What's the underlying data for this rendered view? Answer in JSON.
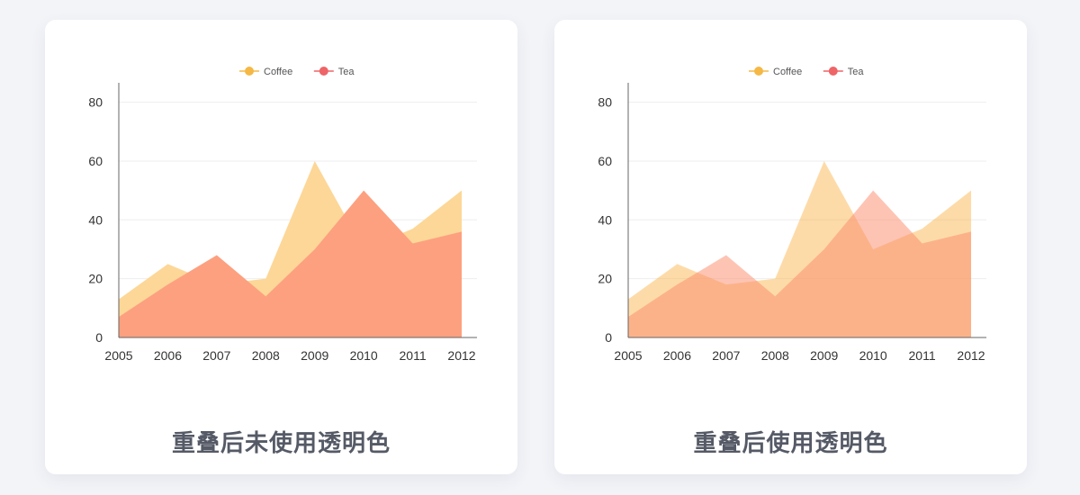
{
  "chart_data": [
    {
      "type": "area",
      "caption": "重叠后未使用透明色",
      "categories": [
        "2005",
        "2006",
        "2007",
        "2008",
        "2009",
        "2010",
        "2011",
        "2012"
      ],
      "series": [
        {
          "name": "Coffee",
          "values": [
            13,
            25,
            18,
            20,
            60,
            30,
            37,
            50
          ],
          "color": "#fdd797",
          "opacity": 1
        },
        {
          "name": "Tea",
          "values": [
            7,
            18,
            28,
            14,
            30,
            50,
            32,
            36
          ],
          "color": "#fda07f",
          "opacity": 1
        }
      ],
      "ylim": [
        0,
        86
      ],
      "yticks": [
        0,
        20,
        40,
        60,
        80
      ],
      "legend_position": "top-center",
      "legend_colors": {
        "Coffee": "#f5b845",
        "Tea": "#ee6467"
      }
    },
    {
      "type": "area",
      "caption": "重叠后使用透明色",
      "categories": [
        "2005",
        "2006",
        "2007",
        "2008",
        "2009",
        "2010",
        "2011",
        "2012"
      ],
      "series": [
        {
          "name": "Coffee",
          "values": [
            13,
            25,
            18,
            20,
            60,
            30,
            37,
            50
          ],
          "color": "#fbb040",
          "opacity": 0.45
        },
        {
          "name": "Tea",
          "values": [
            7,
            18,
            28,
            14,
            30,
            50,
            32,
            36
          ],
          "color": "#fb8a6a",
          "opacity": 0.5
        }
      ],
      "ylim": [
        0,
        86
      ],
      "yticks": [
        0,
        20,
        40,
        60,
        80
      ],
      "legend_position": "top-center",
      "legend_colors": {
        "Coffee": "#f5b845",
        "Tea": "#ee6467"
      }
    }
  ]
}
